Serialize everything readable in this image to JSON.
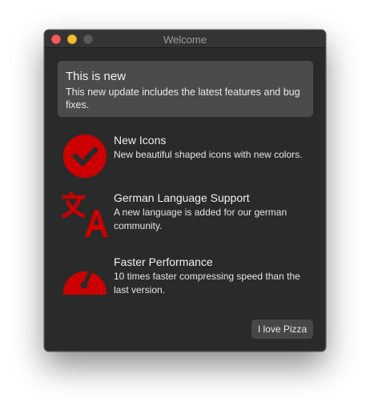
{
  "window": {
    "title": "Welcome"
  },
  "banner": {
    "title": "This is new",
    "body": "This new update includes the latest features and bug fixes."
  },
  "features": [
    {
      "icon": "checkmark-circle-icon",
      "title": "New Icons",
      "body": "New beautiful shaped icons with new colors."
    },
    {
      "icon": "translate-icon",
      "title": "German Language Support",
      "body": "A new language is added for our german community."
    },
    {
      "icon": "speedometer-icon",
      "title": "Faster Performance",
      "body": "10 times faster compressing speed than the last version."
    }
  ],
  "actions": {
    "primary_label": "I love Pizza"
  },
  "colors": {
    "accent": "#cc0000",
    "window_bg": "#2a2a2a",
    "banner_bg": "#4b4b4b"
  }
}
